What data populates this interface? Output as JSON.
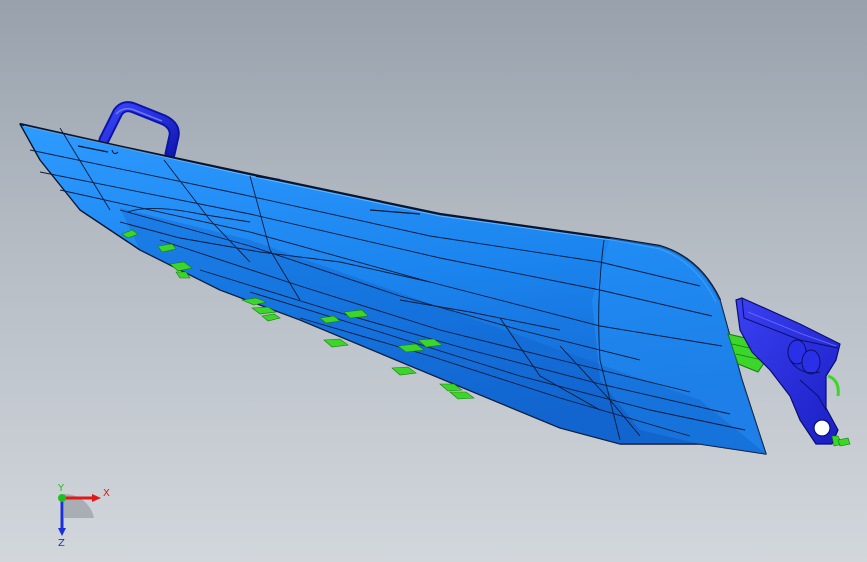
{
  "viewport": {
    "background_top": "#98a1ac",
    "background_bottom": "#d2d7dc"
  },
  "model": {
    "hull_color": "#1f8cf5",
    "hull_dark": "#0a4fb8",
    "handle_color": "#1a24d8",
    "bracket_color": "#2a2ee0",
    "accent_color": "#33dd1f",
    "edge_color": "#0a1530"
  },
  "triad": {
    "x_label": "X",
    "y_label": "Y",
    "z_label": "Z",
    "x_color": "#e01818",
    "y_color": "#1fbf1f",
    "z_color": "#1a2fd8"
  }
}
